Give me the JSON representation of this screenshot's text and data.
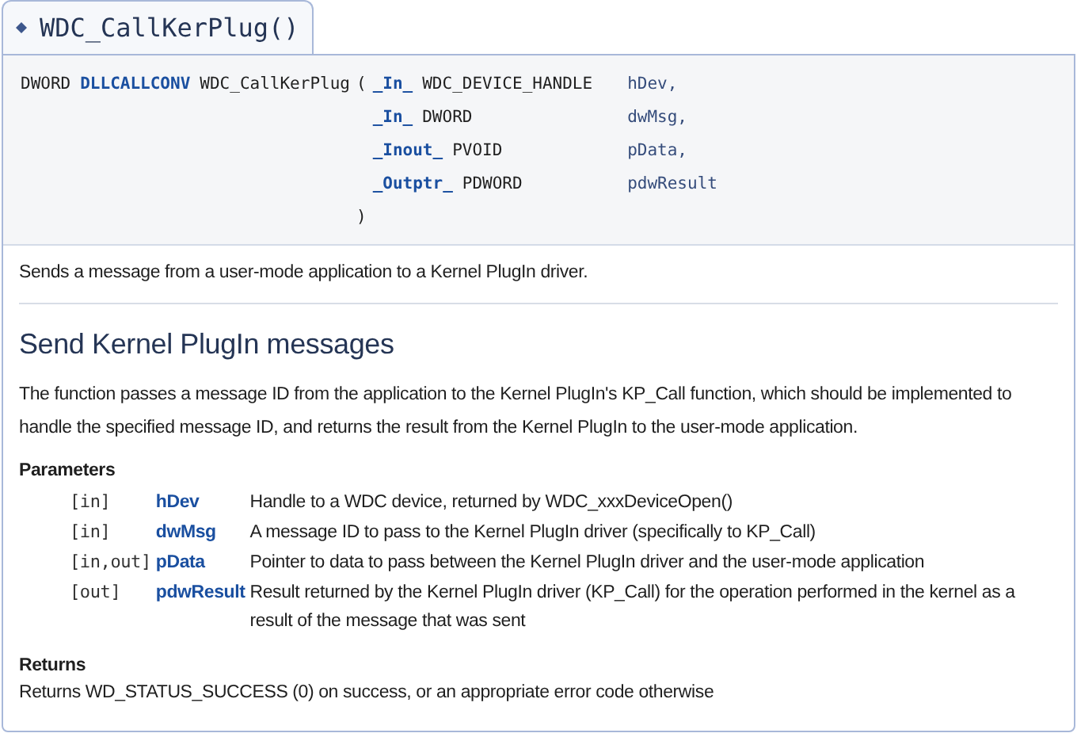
{
  "title": "WDC_CallKerPlug()",
  "signature": {
    "return_type": "DWORD",
    "call_conv": "DLLCALLCONV",
    "name": "WDC_CallKerPlug",
    "open_paren": "(",
    "close_paren": ")",
    "params": [
      {
        "annotation": "_In_",
        "type": "WDC_DEVICE_HANDLE",
        "name": "hDev,"
      },
      {
        "annotation": "_In_",
        "type": "DWORD",
        "name": "dwMsg,"
      },
      {
        "annotation": "_Inout_",
        "type": "PVOID",
        "name": "pData,"
      },
      {
        "annotation": "_Outptr_",
        "type": "PDWORD",
        "name": "pdwResult"
      }
    ]
  },
  "brief": "Sends a message from a user-mode application to a Kernel PlugIn driver.",
  "heading": "Send Kernel PlugIn messages",
  "description": "The function passes a message ID from the application to the Kernel PlugIn's KP_Call function, which should be implemented to handle the specified message ID, and returns the result from the Kernel PlugIn to the user-mode application.",
  "parameters": {
    "title": "Parameters",
    "items": [
      {
        "direction": "[in]",
        "name": "hDev",
        "description": "Handle to a WDC device, returned by WDC_xxxDeviceOpen()"
      },
      {
        "direction": "[in]",
        "name": "dwMsg",
        "description": "A message ID to pass to the Kernel PlugIn driver (specifically to KP_Call)"
      },
      {
        "direction": "[in,out]",
        "name": "pData",
        "description": "Pointer to data to pass between the Kernel PlugIn driver and the user-mode application"
      },
      {
        "direction": "[out]",
        "name": "pdwResult",
        "description": "Result returned by the Kernel PlugIn driver (KP_Call) for the operation performed in the kernel as a result of the message that was sent"
      }
    ]
  },
  "returns": {
    "title": "Returns",
    "text": "Returns WD_STATUS_SUCCESS (0) on success, or an appropriate error code otherwise"
  }
}
